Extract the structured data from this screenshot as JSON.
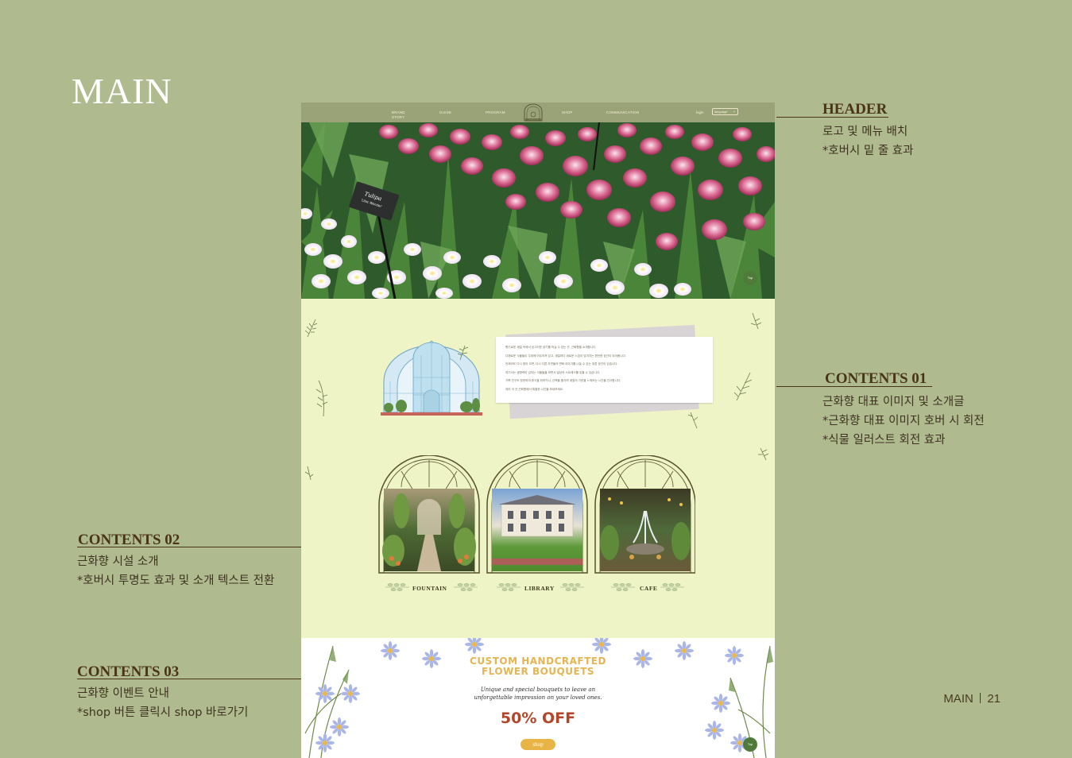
{
  "page": {
    "title": "MAIN",
    "number_label": "MAIN",
    "number": "21"
  },
  "annotations": {
    "header": {
      "title": "HEADER",
      "lines": [
        "로고 및 메뉴 배치",
        "*호버시 밑 줄 효과"
      ]
    },
    "contents01": {
      "title": "CONTENTS 01",
      "lines": [
        "근화향 대표 이미지 및 소개글",
        "*근화향 대표 이미지 호버 시 회전",
        "*식물 일러스트 회전 효과"
      ]
    },
    "contents02": {
      "title": "CONTENTS 02",
      "lines": [
        "근화향 시설 소개",
        "*호버시 투명도 효과 및 소개 텍스트 전환"
      ]
    },
    "contents03": {
      "title": "CONTENTS 03",
      "lines": [
        "근화향 이벤트 안내",
        "*shop 버튼 클릭시 shop 바로가기"
      ]
    }
  },
  "mockup": {
    "nav": {
      "items": [
        "BRAND STORY",
        "GUIDE",
        "PROGRAM",
        "SHOP",
        "COMMUNICATION"
      ],
      "login": "login",
      "language": "language"
    },
    "hero": {
      "sign_title": "Tulipa",
      "sign_sub": "'Lilac Wonder'",
      "top_button": "Top"
    },
    "intro": {
      "lines": [
        "향기로운 계절 속에서 싱그러운 공기를 마실 수 있는 곳, 근화향을 소개합니다.",
        "다채로운 식물들이 주위에 어우러져 있고, 계절마다 새로운 느낌이 담겨지는 편안한 공간이 되어봅니다.",
        "언제라도 다시 찾아 오면, 다시 다른 자연들의 변화 이야기를 나눌 수 있는 푸른 공간이 있습니다.",
        "여기서는 생명력이 넘치는 식물들을 보면서 일상의 스트레스를 잊을 수 있습니다.",
        "가족 친구도 방문하여 휴식을 취하거나, 산책을 즐기며 계절의 기운을 느껴보는 시간을 선사합니다.",
        "여러 이 곳 근화향에서 특별한 시간을 보내보세요."
      ]
    },
    "facilities": [
      {
        "label": "FOUNTAIN"
      },
      {
        "label": "LIBRARY"
      },
      {
        "label": "CAFE"
      }
    ],
    "event": {
      "title_line1": "CUSTOM HANDCRAFTED",
      "title_line2": "FLOWER BOUQUETS",
      "subtitle_line1": "Unique and special bouquets to leave an",
      "subtitle_line2": "unforgettable impression on your loved ones.",
      "offer": "50% OFF",
      "shop_button": "shop",
      "top_button": "Top"
    }
  },
  "colors": {
    "background": "#b0ba8f",
    "annotation_text": "#4a3418",
    "mockup_header": "#9aa277",
    "mockup_body": "#eef4c6",
    "event_title": "#e4b552",
    "offer": "#b2462a",
    "shop_button": "#e8b446"
  }
}
